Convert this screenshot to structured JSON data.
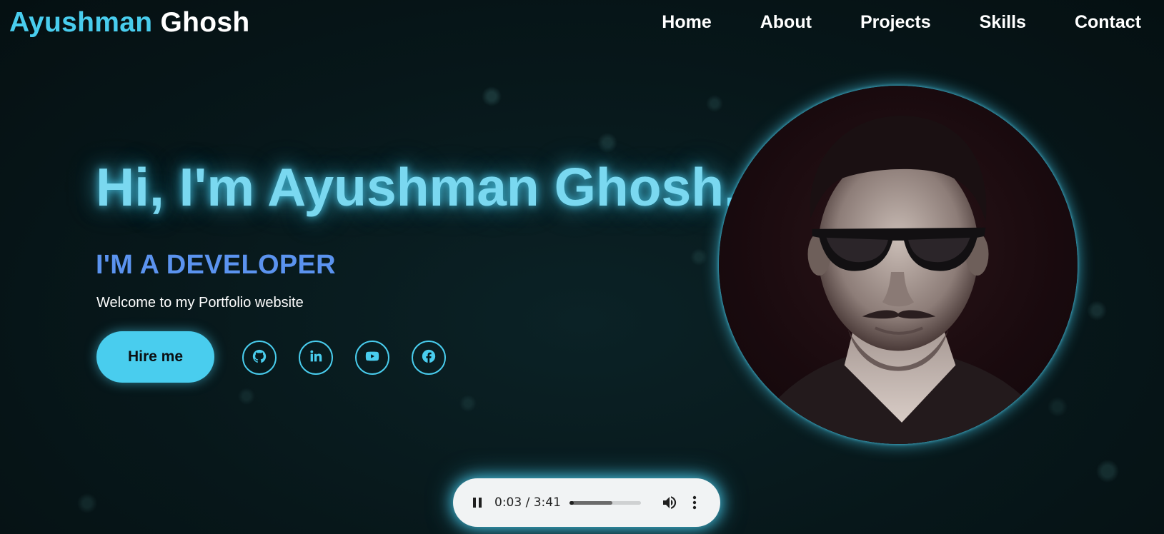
{
  "logo": {
    "first": "Ayushman",
    "last": "Ghosh"
  },
  "nav": {
    "items": [
      {
        "label": "Home"
      },
      {
        "label": "About"
      },
      {
        "label": "Projects"
      },
      {
        "label": "Skills"
      },
      {
        "label": "Contact"
      }
    ]
  },
  "hero": {
    "title": "Hi, I'm Ayushman Ghosh.",
    "role": "I'M A DEVELOPER",
    "welcome": "Welcome to my Portfolio website",
    "hire_label": "Hire me",
    "socials": [
      {
        "icon": "github-icon"
      },
      {
        "icon": "linkedin-icon"
      },
      {
        "icon": "youtube-icon"
      },
      {
        "icon": "facebook-icon"
      }
    ]
  },
  "profile": {
    "icon": "profile-photo"
  },
  "audio": {
    "time": "0:03 / 3:41",
    "played_fraction": 0.06,
    "buffered_fraction": 0.6
  },
  "colors": {
    "accent": "#49cdee",
    "role": "#5b93ef",
    "background": "#061417",
    "title": "#7ad8f0"
  }
}
